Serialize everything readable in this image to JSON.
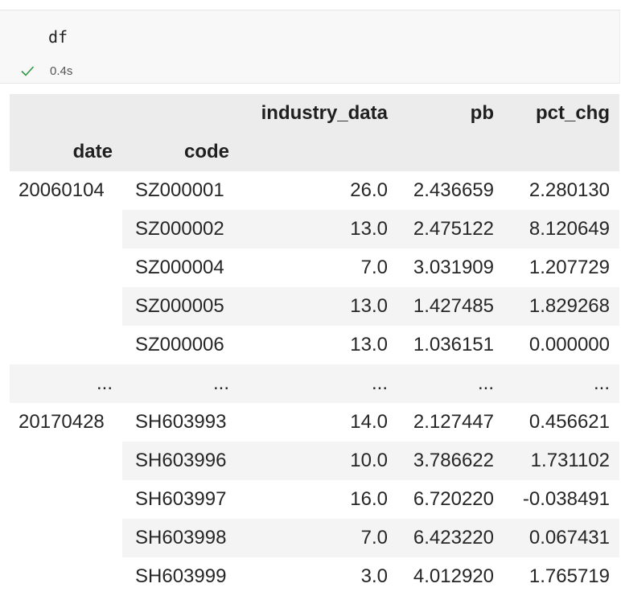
{
  "cell": {
    "code": "df",
    "status_icon": "check-icon",
    "status_color": "#2e9a44",
    "exec_time": "0.4s"
  },
  "table": {
    "columns": [
      "industry_data",
      "pb",
      "pct_chg"
    ],
    "index_names": [
      "date",
      "code"
    ],
    "rows": [
      {
        "date": "20060104",
        "code": "SZ000001",
        "industry_data": "26.0",
        "pb": "2.436659",
        "pct_chg": "2.280130"
      },
      {
        "date": "",
        "code": "SZ000002",
        "industry_data": "13.0",
        "pb": "2.475122",
        "pct_chg": "8.120649"
      },
      {
        "date": "",
        "code": "SZ000004",
        "industry_data": "7.0",
        "pb": "3.031909",
        "pct_chg": "1.207729"
      },
      {
        "date": "",
        "code": "SZ000005",
        "industry_data": "13.0",
        "pb": "1.427485",
        "pct_chg": "1.829268"
      },
      {
        "date": "",
        "code": "SZ000006",
        "industry_data": "13.0",
        "pb": "1.036151",
        "pct_chg": "0.000000"
      },
      {
        "date": "...",
        "code": "...",
        "industry_data": "...",
        "pb": "...",
        "pct_chg": "..."
      },
      {
        "date": "20170428",
        "code": "SH603993",
        "industry_data": "14.0",
        "pb": "2.127447",
        "pct_chg": "0.456621"
      },
      {
        "date": "",
        "code": "SH603996",
        "industry_data": "10.0",
        "pb": "3.786622",
        "pct_chg": "1.731102"
      },
      {
        "date": "",
        "code": "SH603997",
        "industry_data": "16.0",
        "pb": "6.720220",
        "pct_chg": "-0.038491"
      },
      {
        "date": "",
        "code": "SH603998",
        "industry_data": "7.0",
        "pb": "6.423220",
        "pct_chg": "0.067431"
      },
      {
        "date": "",
        "code": "SH603999",
        "industry_data": "3.0",
        "pb": "4.012920",
        "pct_chg": "1.765719"
      }
    ]
  }
}
